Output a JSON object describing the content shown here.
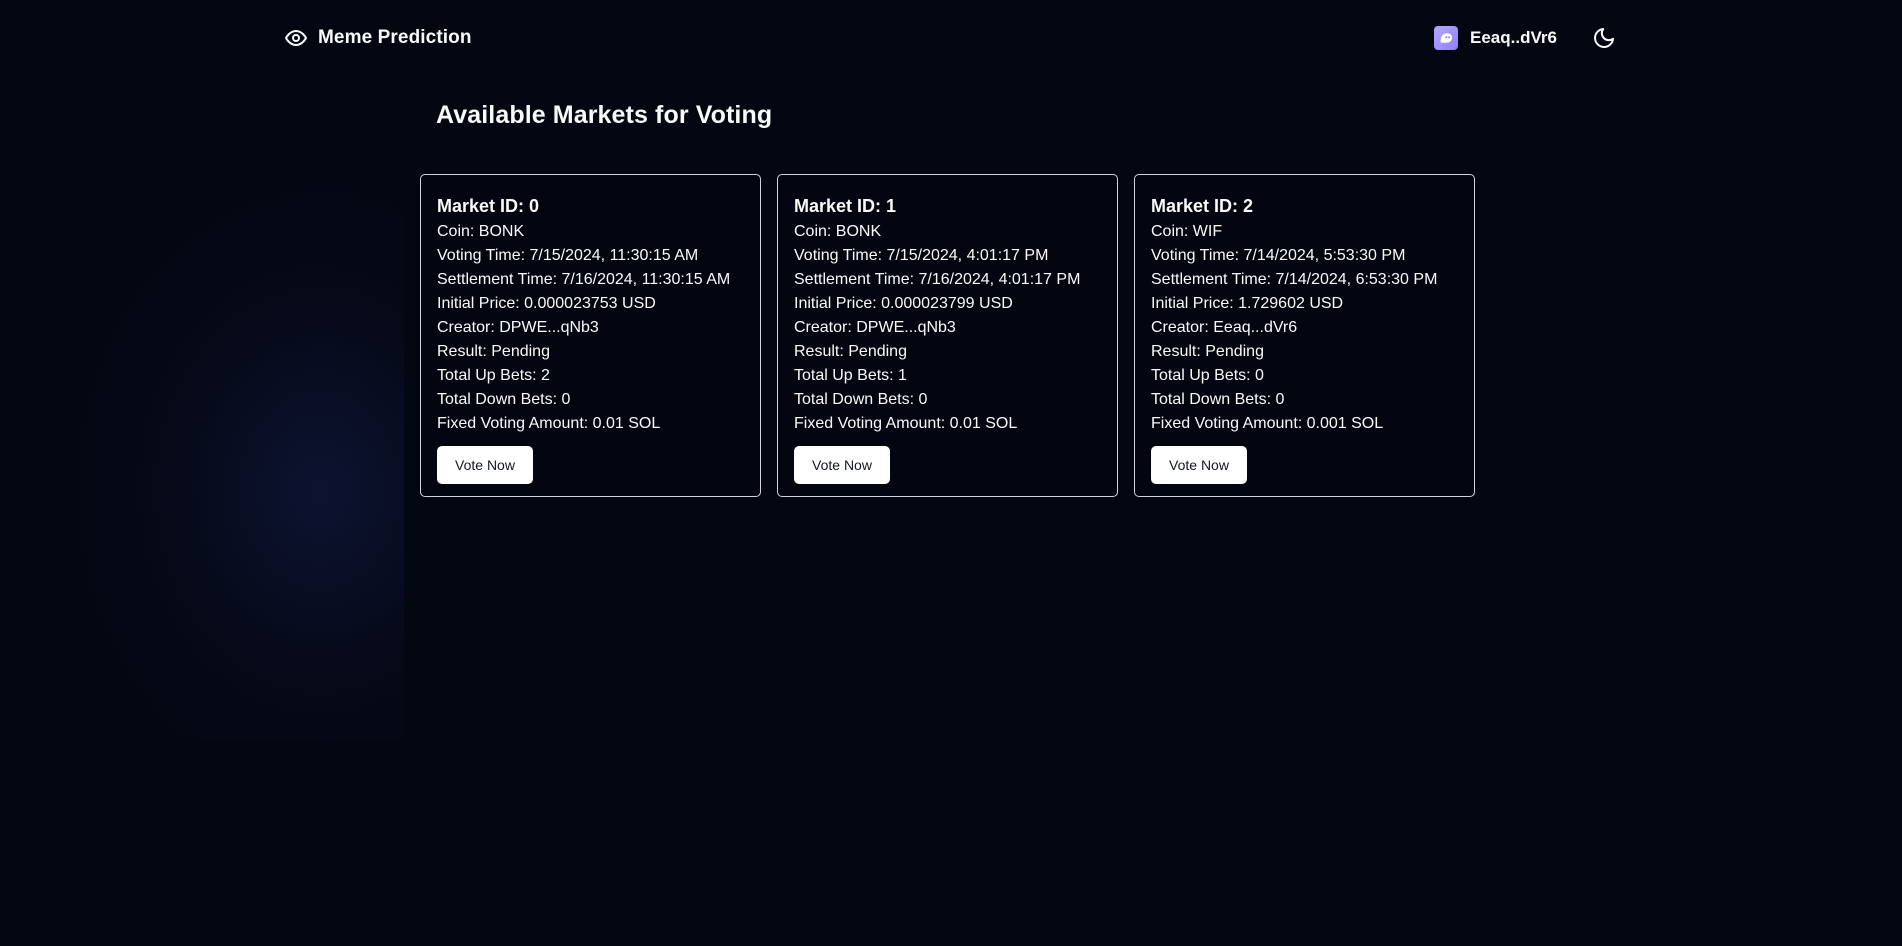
{
  "header": {
    "brand_icon": "eye-icon",
    "brand_title": "Meme Prediction",
    "wallet_icon": "wallet-logo-icon",
    "wallet_address": "Eeaq..dVr6",
    "theme_icon": "moon-icon"
  },
  "main": {
    "title": "Available Markets for Voting",
    "markets": [
      {
        "market_id": "Market ID: 0",
        "coin": "Coin: BONK",
        "voting_time": "Voting Time: 7/15/2024, 11:30:15 AM",
        "settlement_time": "Settlement Time: 7/16/2024, 11:30:15 AM",
        "initial_price": "Initial Price: 0.000023753 USD",
        "creator": "Creator: DPWE...qNb3",
        "result": "Result: Pending",
        "total_up_bets": "Total Up Bets: 2",
        "total_down_bets": "Total Down Bets: 0",
        "fixed_voting_amount": "Fixed Voting Amount: 0.01 SOL",
        "button_label": "Vote Now"
      },
      {
        "market_id": "Market ID: 1",
        "coin": "Coin: BONK",
        "voting_time": "Voting Time: 7/15/2024, 4:01:17 PM",
        "settlement_time": "Settlement Time: 7/16/2024, 4:01:17 PM",
        "initial_price": "Initial Price: 0.000023799 USD",
        "creator": "Creator: DPWE...qNb3",
        "result": "Result: Pending",
        "total_up_bets": "Total Up Bets: 1",
        "total_down_bets": "Total Down Bets: 0",
        "fixed_voting_amount": "Fixed Voting Amount: 0.01 SOL",
        "button_label": "Vote Now"
      },
      {
        "market_id": "Market ID: 2",
        "coin": "Coin: WIF",
        "voting_time": "Voting Time: 7/14/2024, 5:53:30 PM",
        "settlement_time": "Settlement Time: 7/14/2024, 6:53:30 PM",
        "initial_price": "Initial Price: 1.729602 USD",
        "creator": "Creator: Eeaq...dVr6",
        "result": "Result: Pending",
        "total_up_bets": "Total Up Bets: 0",
        "total_down_bets": "Total Down Bets: 0",
        "fixed_voting_amount": "Fixed Voting Amount: 0.001 SOL",
        "button_label": "Vote Now"
      }
    ]
  },
  "colors": {
    "background": "#030712",
    "text": "#f8fafc",
    "card_border": "#d1d5db",
    "button_bg": "#ffffff",
    "button_text": "#111827",
    "wallet_icon_accent": "#a79bff"
  }
}
